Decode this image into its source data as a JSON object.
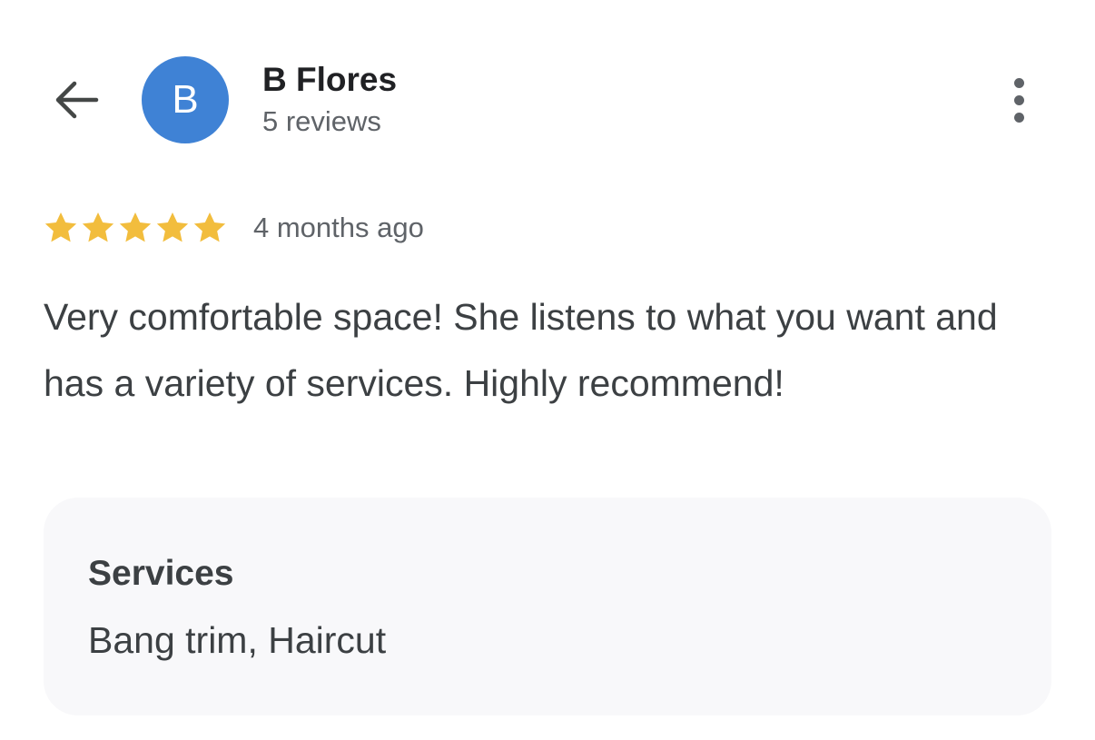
{
  "header": {
    "back_icon": "arrow-left-icon",
    "avatar_letter": "B",
    "avatar_color": "#3f82d5",
    "reviewer_name": "B Flores",
    "review_count": "5 reviews",
    "more_icon": "more-vertical-icon"
  },
  "review": {
    "rating": 5,
    "rating_max": 5,
    "star_color": "#f2bd3d",
    "date": "4 months ago",
    "text": "Very comfortable space! She listens to what you want and has a variety of services. Highly recommend!"
  },
  "services": {
    "title": "Services",
    "value": "Bang trim, Haircut"
  }
}
